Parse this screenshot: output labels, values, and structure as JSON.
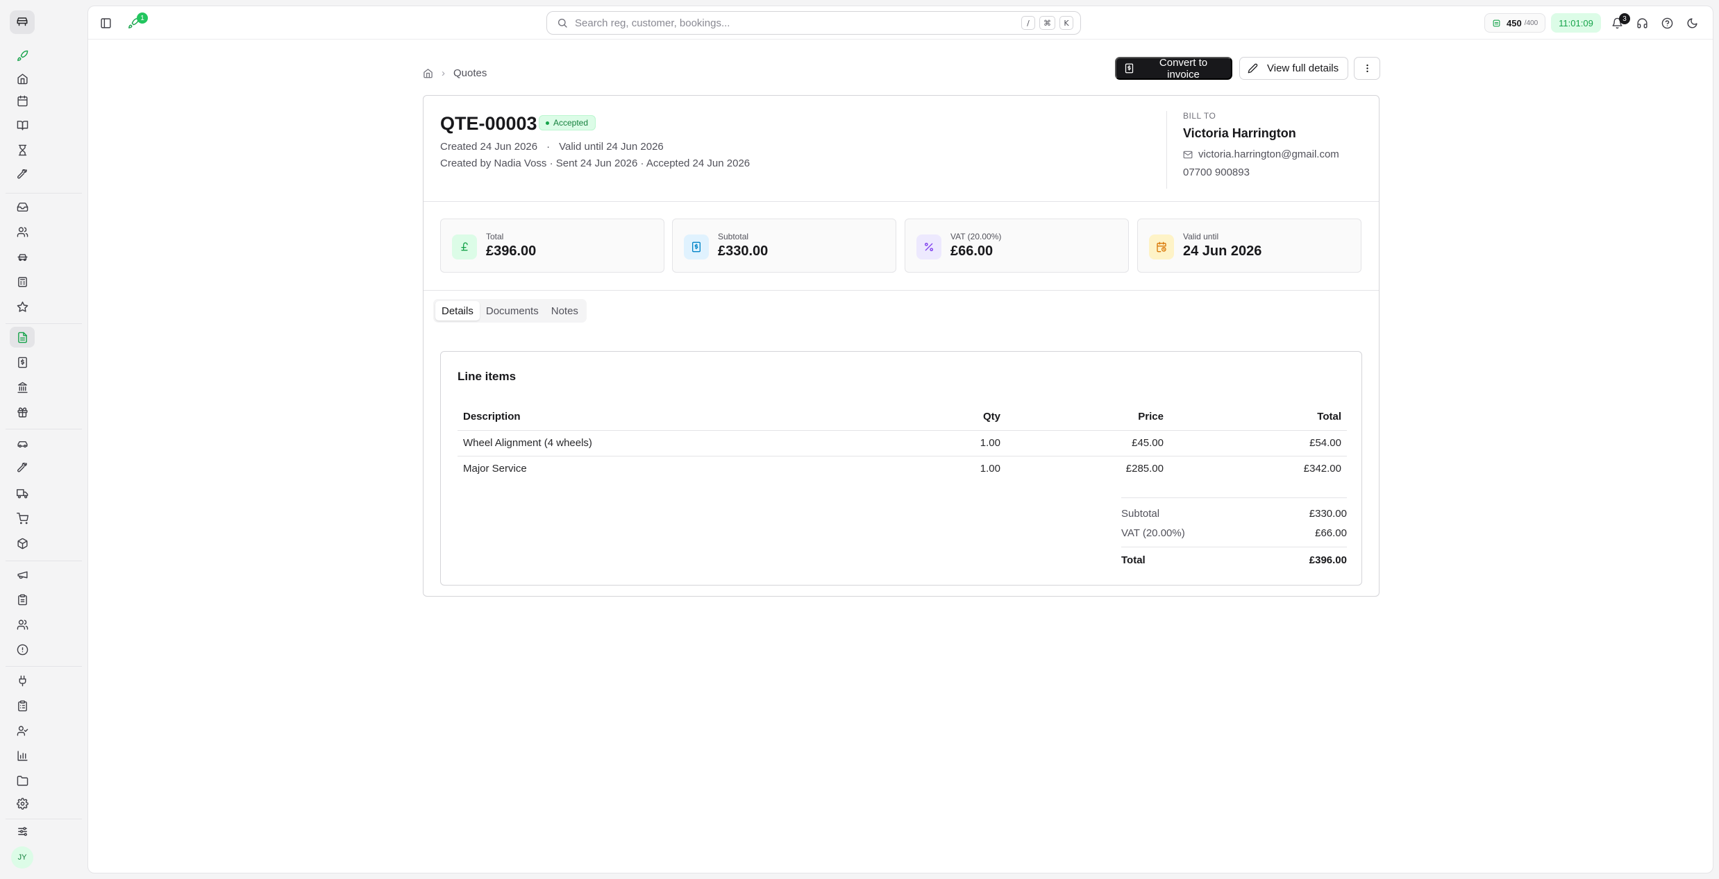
{
  "topbar": {
    "tasks_badge": "1",
    "search_placeholder": "Search reg, customer, bookings...",
    "kbd_slash": "/",
    "kbd_cmd": "⌘",
    "kbd_k": "K",
    "credits_value": "450",
    "credits_max": "/400",
    "clock": "11:01:09",
    "notifications_count": "3"
  },
  "sidebar": {
    "avatar_initials": "JY",
    "items": [
      {
        "name": "rocket",
        "icon": "rocket-icon"
      },
      {
        "name": "home",
        "icon": "home-icon"
      },
      {
        "name": "calendar",
        "icon": "calendar-icon"
      },
      {
        "name": "book",
        "icon": "book-icon"
      },
      {
        "name": "hourglass",
        "icon": "hourglass-icon"
      },
      {
        "name": "wrench",
        "icon": "wrench-icon"
      },
      {
        "name": "inbox",
        "icon": "inbox-icon"
      },
      {
        "name": "customers",
        "icon": "users-icon"
      },
      {
        "name": "vehicles",
        "icon": "car-icon"
      },
      {
        "name": "calculator",
        "icon": "calculator-icon"
      },
      {
        "name": "reviews",
        "icon": "star-icon"
      },
      {
        "name": "quotes",
        "icon": "file-text-icon",
        "active": true
      },
      {
        "name": "invoices",
        "icon": "receipt-icon"
      },
      {
        "name": "bank",
        "icon": "landmark-icon"
      },
      {
        "name": "gifts",
        "icon": "gift-icon"
      },
      {
        "name": "fleet",
        "icon": "car-front-icon"
      },
      {
        "name": "tools",
        "icon": "tool-icon"
      },
      {
        "name": "delivery",
        "icon": "truck-icon"
      },
      {
        "name": "cart",
        "icon": "cart-icon"
      },
      {
        "name": "parts",
        "icon": "package-icon"
      },
      {
        "name": "marketing",
        "icon": "megaphone-icon"
      },
      {
        "name": "clipboard",
        "icon": "clipboard-icon"
      },
      {
        "name": "staff",
        "icon": "user-group-icon"
      },
      {
        "name": "alerts",
        "icon": "alert-circle-icon"
      },
      {
        "name": "integrations",
        "icon": "plug-icon"
      },
      {
        "name": "checklist",
        "icon": "clipboard-list-icon"
      },
      {
        "name": "roles",
        "icon": "user-check-icon"
      },
      {
        "name": "reports",
        "icon": "bar-chart-icon"
      },
      {
        "name": "files",
        "icon": "folder-icon"
      },
      {
        "name": "settings",
        "icon": "gear-icon"
      },
      {
        "name": "preferences",
        "icon": "sliders-icon"
      }
    ]
  },
  "breadcrumb": {
    "section": "Quotes"
  },
  "actions": {
    "convert_label": "Convert to invoice",
    "view_label": "View full details"
  },
  "quote": {
    "number": "QTE-00003",
    "status": "Accepted",
    "created": "Created 24 Jun 2026",
    "valid_until": "Valid until 24 Jun 2026",
    "meta_dot": "·",
    "history": "Created by Nadia Voss · Sent 24 Jun 2026 · Accepted 24 Jun 2026"
  },
  "bill_to": {
    "label": "BILL TO",
    "name": "Victoria Harrington",
    "email": "victoria.harrington@gmail.com",
    "phone": "07700 900893"
  },
  "stats": [
    {
      "label": "Total",
      "value": "£396.00",
      "icon": "pound-icon",
      "color": "#16a34a",
      "bg": "#dcfce7"
    },
    {
      "label": "Subtotal",
      "value": "£330.00",
      "icon": "receipt-icon",
      "color": "#0284c7",
      "bg": "#e0f2fe"
    },
    {
      "label": "VAT (20.00%)",
      "value": "£66.00",
      "icon": "percent-icon",
      "color": "#7c3aed",
      "bg": "#ede9fe"
    },
    {
      "label": "Valid until",
      "value": "24 Jun 2026",
      "icon": "calendar-clock-icon",
      "color": "#d97706",
      "bg": "#fef3c7"
    }
  ],
  "tabs": [
    {
      "label": "Details",
      "active": true
    },
    {
      "label": "Documents",
      "active": false
    },
    {
      "label": "Notes",
      "active": false
    }
  ],
  "line_items": {
    "title": "Line items",
    "columns": [
      "Description",
      "Qty",
      "Price",
      "Total"
    ],
    "rows": [
      {
        "description": "Wheel Alignment (4 wheels)",
        "qty": "1.00",
        "price": "£45.00",
        "total": "£54.00"
      },
      {
        "description": "Major Service",
        "qty": "1.00",
        "price": "£285.00",
        "total": "£342.00"
      }
    ]
  },
  "totals": {
    "subtotal_label": "Subtotal",
    "subtotal_value": "£330.00",
    "vat_label": "VAT (20.00%)",
    "vat_value": "£66.00",
    "total_label": "Total",
    "total_value": "£396.00"
  },
  "colors": {
    "accent": "#16a34a",
    "primary_button": "#18181b",
    "status_bg": "#dcfce7"
  }
}
